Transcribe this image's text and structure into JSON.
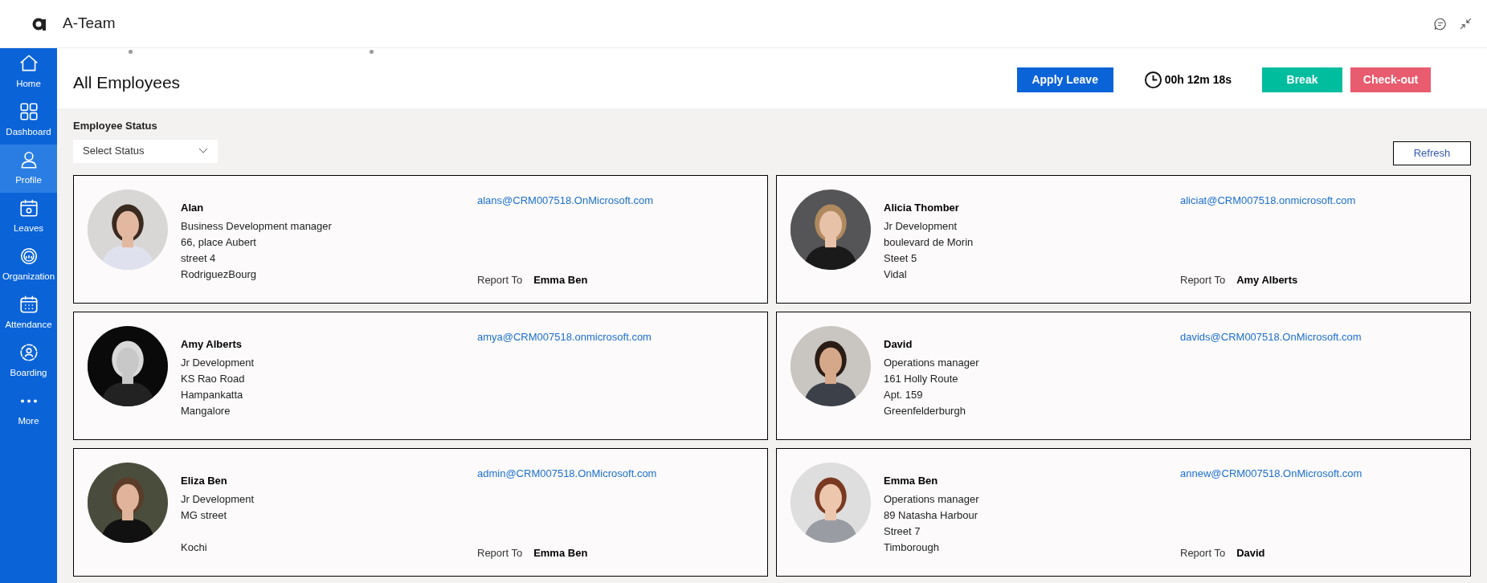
{
  "app": {
    "title": "A-Team"
  },
  "sidebar": {
    "items": [
      {
        "label": "Home",
        "kind": "home",
        "selected": false
      },
      {
        "label": "Dashboard",
        "kind": "dashboard",
        "selected": false
      },
      {
        "label": "Profile",
        "kind": "profile",
        "selected": true
      },
      {
        "label": "Leaves",
        "kind": "leaves",
        "selected": false
      },
      {
        "label": "Organization",
        "kind": "organization",
        "selected": false
      },
      {
        "label": "Attendance",
        "kind": "attendance",
        "selected": false
      },
      {
        "label": "Boarding",
        "kind": "boarding",
        "selected": false
      },
      {
        "label": "More",
        "kind": "more",
        "selected": false
      }
    ]
  },
  "page": {
    "title": "All Employees",
    "apply_leave": "Apply Leave",
    "timer": "00h 12m 18s",
    "break": "Break",
    "checkout": "Check-out"
  },
  "filter": {
    "label": "Employee Status",
    "placeholder": "Select Status",
    "refresh": "Refresh"
  },
  "employees": [
    {
      "name": "Alan",
      "title": "Business Development manager",
      "address": [
        "66, place Aubert",
        "street 4"
      ],
      "city": "RodriguezBourg",
      "email": "alans@CRM007518.OnMicrosoft.com",
      "report_label": "Report To",
      "report_to": "Emma Ben"
    },
    {
      "name": "Alicia Thomber",
      "title": "Jr Development",
      "address": [
        "boulevard de Morin",
        "Steet 5"
      ],
      "city": "Vidal",
      "email": "aliciat@CRM007518.onmicrosoft.com",
      "report_label": "Report To",
      "report_to": "Amy Alberts"
    },
    {
      "name": "Amy Alberts",
      "title": "Jr Development",
      "address": [
        "KS Rao Road",
        "Hampankatta"
      ],
      "city": "Mangalore",
      "email": "amya@CRM007518.onmicrosoft.com"
    },
    {
      "name": "David",
      "title": "Operations manager",
      "address": [
        "161 Holly Route",
        "Apt. 159"
      ],
      "city": "Greenfelderburgh",
      "email": "davids@CRM007518.OnMicrosoft.com"
    },
    {
      "name": "Eliza Ben",
      "title": "Jr Development",
      "address": [
        "MG street"
      ],
      "city": "Kochi",
      "email": "admin@CRM007518.OnMicrosoft.com",
      "report_label": "Report To",
      "report_to": "Emma Ben"
    },
    {
      "name": "Emma Ben",
      "title": "Operations manager",
      "address": [
        "89 Natasha Harbour",
        "Street 7"
      ],
      "city": "Timborough",
      "email": "annew@CRM007518.OnMicrosoft.com",
      "report_label": "Report To",
      "report_to": "David"
    }
  ]
}
